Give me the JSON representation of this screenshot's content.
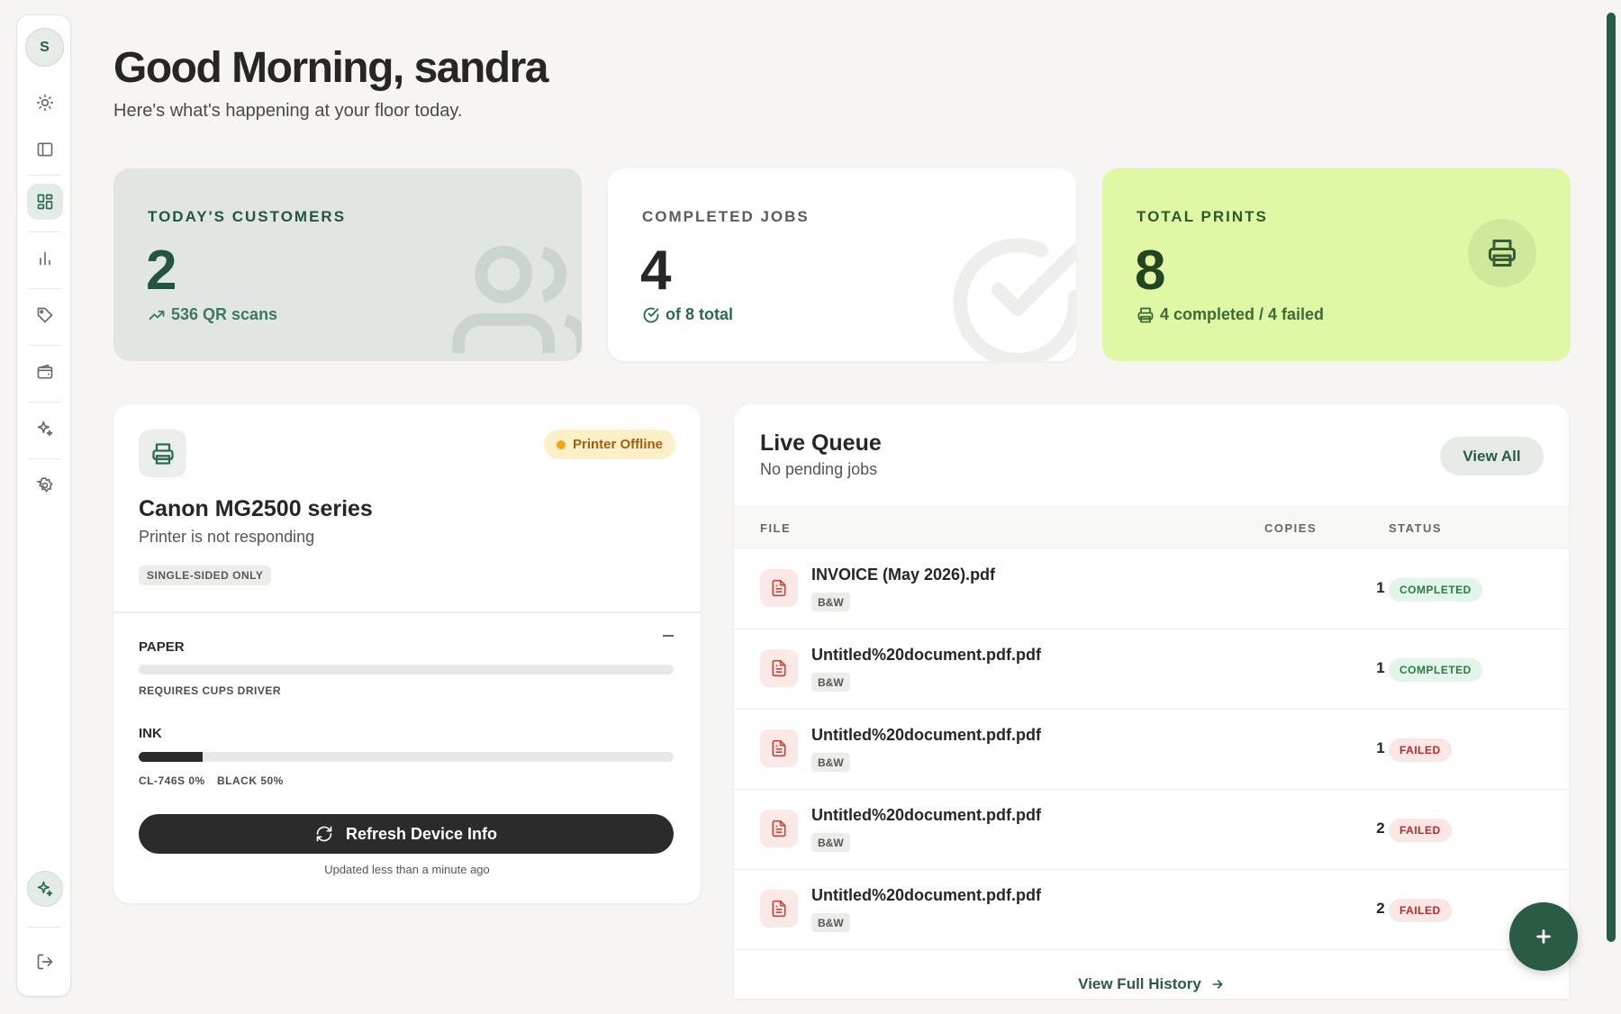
{
  "user": {
    "initial": "S"
  },
  "header": {
    "greeting": "Good Morning, sandra",
    "subtitle": "Here's what's happening at your floor today."
  },
  "stats": {
    "customers": {
      "label": "TODAY'S CUSTOMERS",
      "value": "2",
      "footer": "536 QR scans"
    },
    "completed": {
      "label": "COMPLETED JOBS",
      "value": "4",
      "footer": "of 8 total"
    },
    "prints": {
      "label": "TOTAL PRINTS",
      "value": "8",
      "footer": "4 completed / 4 failed"
    }
  },
  "printer": {
    "status_badge": "Printer Offline",
    "name": "Canon MG2500 series",
    "status_text": "Printer is not responding",
    "capability": "SINGLE-SIDED ONLY",
    "paper": {
      "label": "PAPER",
      "note": "REQUIRES CUPS DRIVER",
      "level": 0
    },
    "ink": {
      "label": "INK",
      "level": 0.12,
      "cartridges": [
        "CL-746S 0%",
        "BLACK 50%"
      ]
    },
    "refresh_label": "Refresh Device Info",
    "updated": "Updated less than a minute ago"
  },
  "queue": {
    "title": "Live Queue",
    "subtitle": "No pending jobs",
    "view_all": "View All",
    "columns": {
      "file": "FILE",
      "copies": "COPIES",
      "status": "STATUS"
    },
    "rows": [
      {
        "file": "INVOICE (May 2026).pdf",
        "mode": "B&W",
        "copies": "1",
        "status": "COMPLETED"
      },
      {
        "file": "Untitled%20document.pdf.pdf",
        "mode": "B&W",
        "copies": "1",
        "status": "COMPLETED"
      },
      {
        "file": "Untitled%20document.pdf.pdf",
        "mode": "B&W",
        "copies": "1",
        "status": "FAILED"
      },
      {
        "file": "Untitled%20document.pdf.pdf",
        "mode": "B&W",
        "copies": "2",
        "status": "FAILED"
      },
      {
        "file": "Untitled%20document.pdf.pdf",
        "mode": "B&W",
        "copies": "2",
        "status": "FAILED"
      }
    ],
    "history_link": "View Full History"
  },
  "colors": {
    "brand": "#2a5c45",
    "accent_lime": "#e0f7a6",
    "offline": "#f0a41b",
    "failed": "#b52c2c",
    "completed": "#2a7a4c"
  },
  "icons": [
    "theme-icon",
    "sidebar-toggle-icon",
    "dashboard-icon",
    "analytics-icon",
    "tag-icon",
    "wallet-icon",
    "sparkles-icon",
    "settings-icon",
    "ai-assistant-icon",
    "logout-icon"
  ]
}
